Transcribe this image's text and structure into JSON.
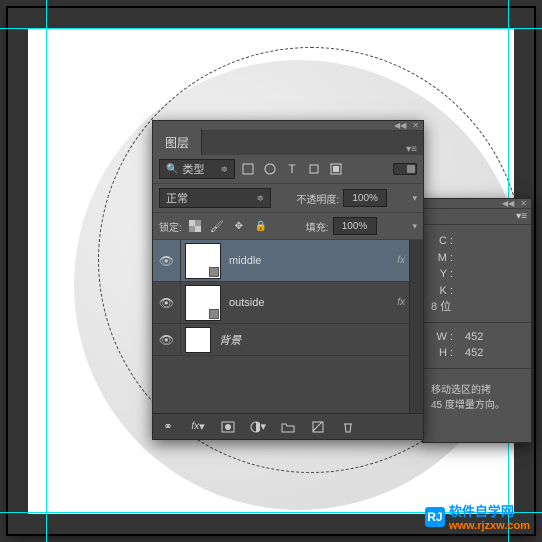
{
  "layers_panel": {
    "title": "图层",
    "filter_label": "类型",
    "blend_mode": "正常",
    "opacity_label": "不透明度:",
    "opacity_value": "100%",
    "lock_label": "锁定:",
    "fill_label": "填充:",
    "fill_value": "100%",
    "layers": [
      {
        "name": "middle",
        "fx": "fx",
        "selected": true
      },
      {
        "name": "outside",
        "fx": "fx",
        "selected": false
      },
      {
        "name": "背景",
        "locked": true,
        "bg": true
      }
    ]
  },
  "info_panel": {
    "color": {
      "C": "",
      "M": "",
      "Y": "",
      "K": ""
    },
    "depth": "8 位",
    "dim": {
      "W": "452",
      "H": "452"
    },
    "tip_line1": "移动选区的拷",
    "tip_line2": "45 度增量方向。"
  },
  "watermark": {
    "brand": "软件自学网",
    "url": "www.rjzxw.com",
    "badge": "RJ"
  }
}
